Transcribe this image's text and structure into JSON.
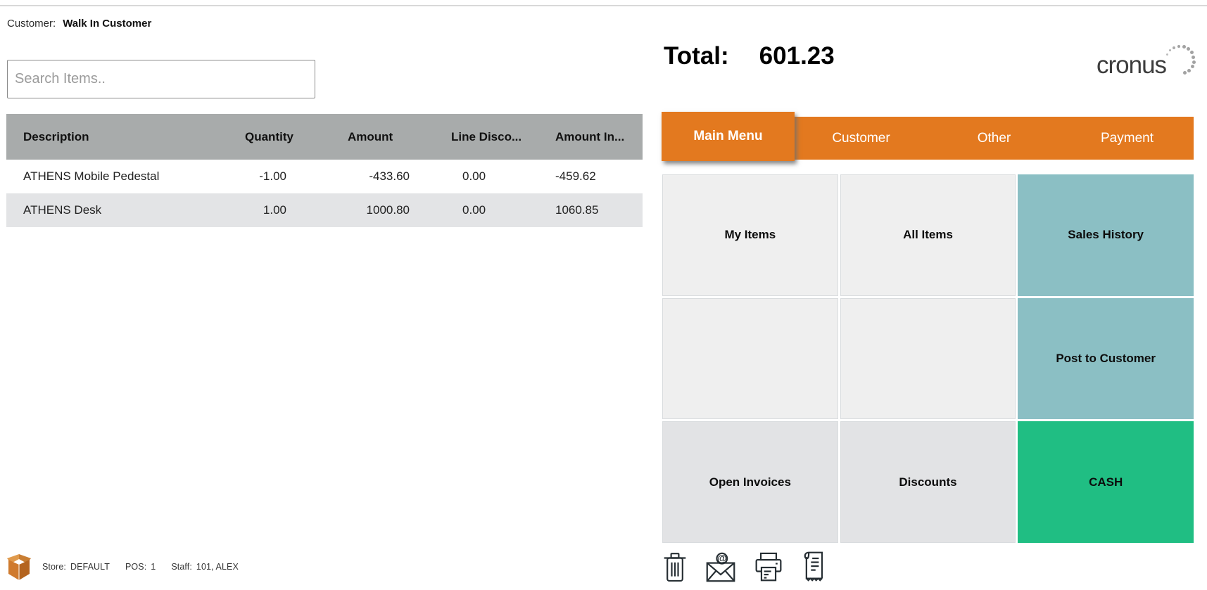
{
  "customer": {
    "label": "Customer:",
    "value": "Walk In Customer"
  },
  "search": {
    "placeholder": "Search Items.."
  },
  "table": {
    "columns": [
      "Description",
      "Quantity",
      "Amount",
      "Line Disco...",
      "Amount In..."
    ],
    "rows": [
      {
        "description": "ATHENS Mobile Pedestal",
        "quantity": "-1.00",
        "amount": "-433.60",
        "line_discount": "0.00",
        "amount_incl": "-459.62"
      },
      {
        "description": "ATHENS Desk",
        "quantity": "1.00",
        "amount": "1000.80",
        "line_discount": "0.00",
        "amount_incl": "1060.85"
      }
    ]
  },
  "total": {
    "label": "Total:",
    "value": "601.23"
  },
  "brand": {
    "name": "cronus",
    "logo_decoration": "dotted-arc"
  },
  "tabs": {
    "items": [
      {
        "label": "Main Menu",
        "active": true
      },
      {
        "label": "Customer",
        "active": false
      },
      {
        "label": "Other",
        "active": false
      },
      {
        "label": "Payment",
        "active": false
      }
    ]
  },
  "menu": {
    "cells": [
      {
        "label": "My Items",
        "variant": "light"
      },
      {
        "label": "All Items",
        "variant": "light"
      },
      {
        "label": "Sales History",
        "variant": "teal"
      },
      {
        "label": "",
        "variant": "light"
      },
      {
        "label": "",
        "variant": "light"
      },
      {
        "label": "Post to Customer",
        "variant": "teal"
      },
      {
        "label": "Open Invoices",
        "variant": "light2"
      },
      {
        "label": "Discounts",
        "variant": "light2"
      },
      {
        "label": "CASH",
        "variant": "green"
      }
    ]
  },
  "action_icons": [
    {
      "name": "delete-icon"
    },
    {
      "name": "email-icon"
    },
    {
      "name": "print-icon"
    },
    {
      "name": "receipt-icon"
    }
  ],
  "status_bar": {
    "store_label": "Store:",
    "store_value": "DEFAULT",
    "pos_label": "POS:",
    "pos_value": "1",
    "staff_label": "Staff:",
    "staff_value": "101, ALEX"
  },
  "colors": {
    "accent_orange": "#e3791f",
    "teal": "#8bbfc4",
    "green": "#20be83",
    "table_header_gray": "#a8abab",
    "row_alt_gray": "#e3e4e6"
  }
}
